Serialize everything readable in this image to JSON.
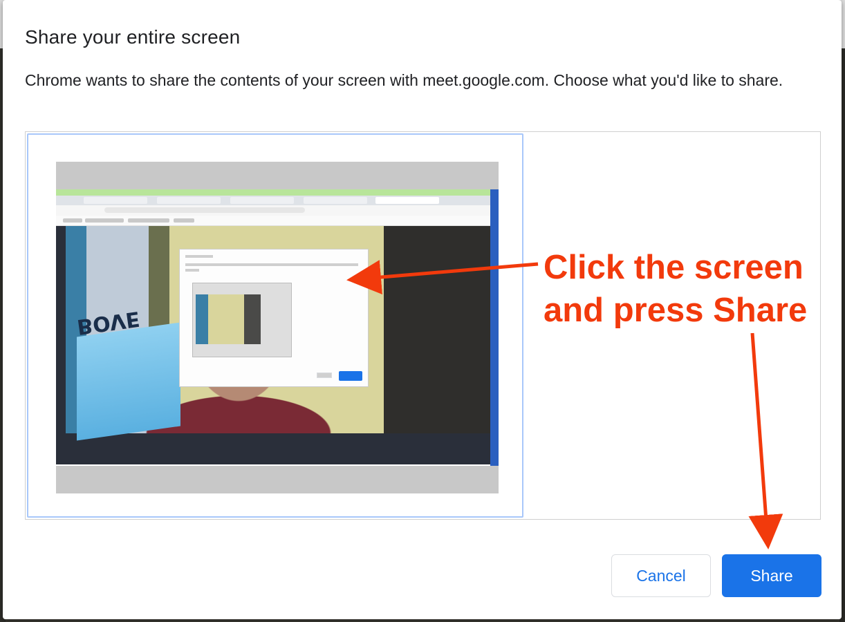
{
  "dialog": {
    "title": "Share your entire screen",
    "description": "Chrome wants to share the contents of your screen with meet.google.com. Choose what you'd like to share."
  },
  "sources": [
    {
      "type": "entire-screen",
      "selected": true
    }
  ],
  "annotation": {
    "line1": "Click the screen",
    "line2": "and press Share",
    "color": "#f23a0c"
  },
  "thumbnail": {
    "jersey_text": "BOVE"
  },
  "buttons": {
    "cancel_label": "Cancel",
    "share_label": "Share"
  },
  "colors": {
    "accent": "#1a73e8",
    "selection_border": "#a8c7fa"
  }
}
